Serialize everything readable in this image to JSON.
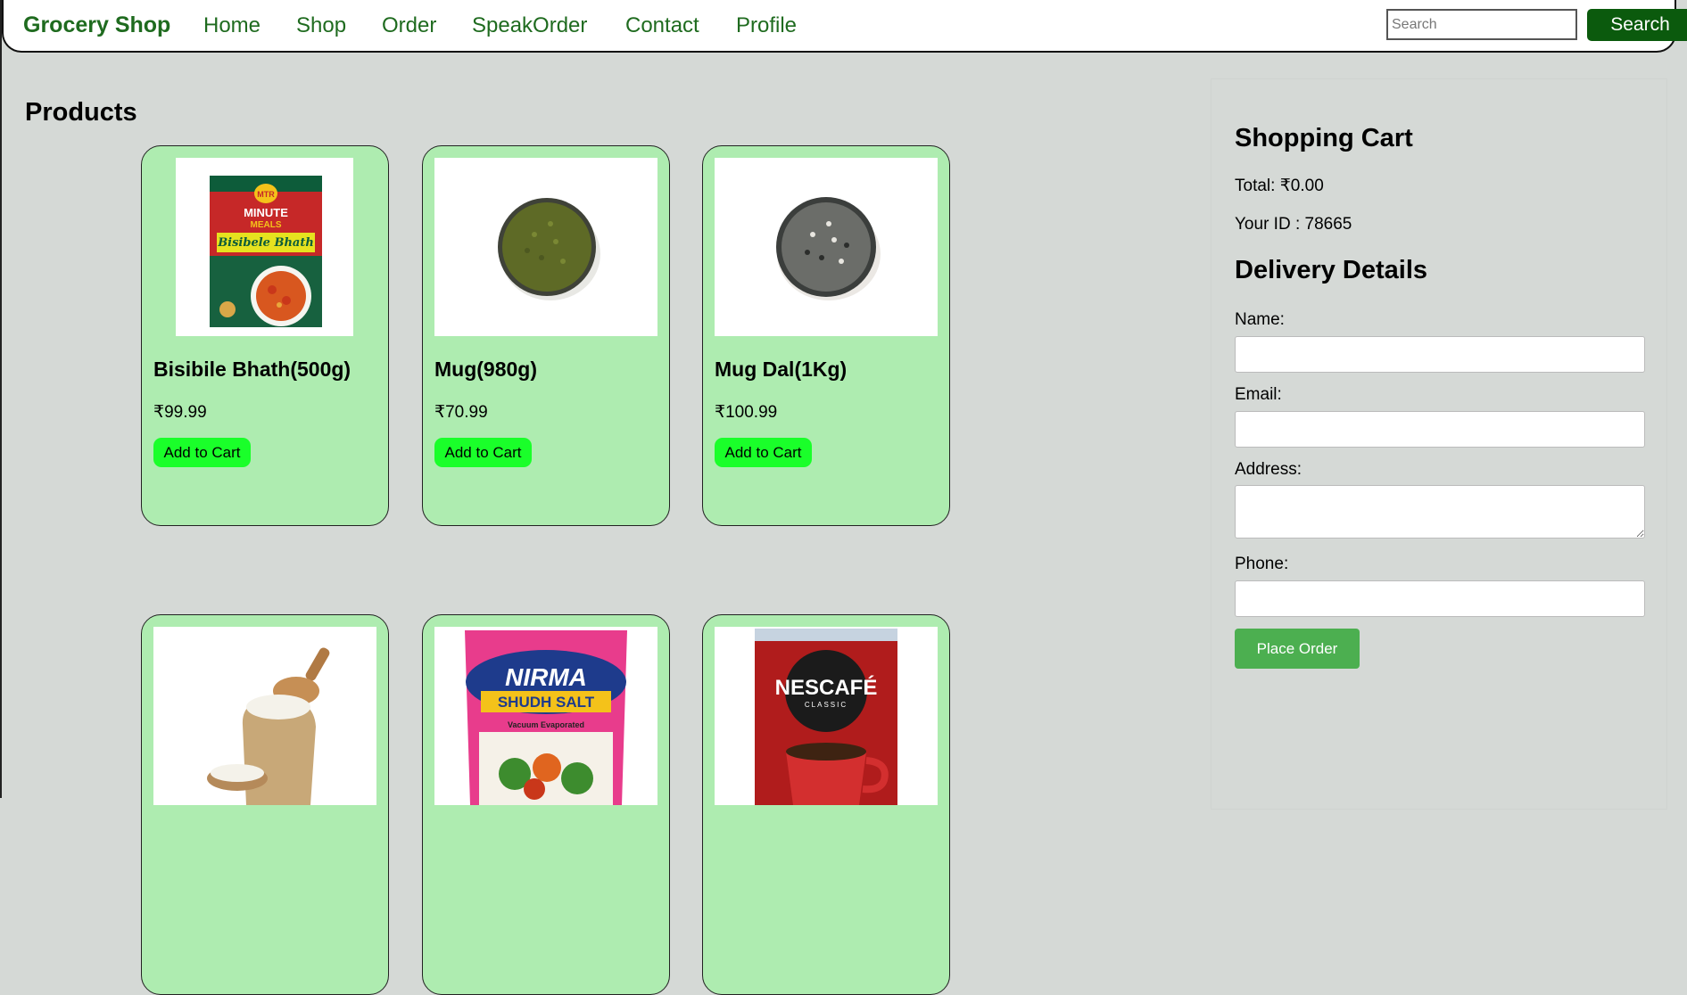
{
  "navbar": {
    "brand": "Grocery Shop",
    "links": [
      "Home",
      "Shop",
      "Order",
      "SpeakOrder",
      "Contact",
      "Profile"
    ],
    "search_placeholder": "Search",
    "search_button": "Search"
  },
  "products": {
    "heading": "Products",
    "add_label": "Add to Cart",
    "items": [
      {
        "name": "Bisibile Bhath(500g)",
        "price": "₹99.99"
      },
      {
        "name": "Mug(980g)",
        "price": "₹70.99"
      },
      {
        "name": "Mug Dal(1Kg)",
        "price": "₹100.99"
      },
      {
        "name": "",
        "price": ""
      },
      {
        "name": "",
        "price": ""
      },
      {
        "name": "",
        "price": ""
      }
    ],
    "image_text": {
      "mtr_brand": "MTR",
      "mtr_line1": "MINUTE",
      "mtr_line2": "MEALS",
      "mtr_product": "Bisibele Bhath",
      "nirma_brand": "NIRMA",
      "nirma_product": "SHUDH SALT",
      "nirma_sub": "Vacuum Evaporated",
      "nescafe_brand": "NESCAFÉ",
      "nescafe_sub": "CLASSIC"
    }
  },
  "cart": {
    "heading": "Shopping Cart",
    "total": "Total: ₹0.00",
    "user_id": "Your ID : 78665"
  },
  "delivery": {
    "heading": "Delivery Details",
    "name_label": "Name:",
    "email_label": "Email:",
    "address_label": "Address:",
    "phone_label": "Phone:",
    "place_order": "Place Order"
  },
  "colors": {
    "page_bg": "#d5d9d6",
    "brand_green": "#1f6b1f",
    "card_bg": "#aeecb0",
    "add_button": "#1aff2a",
    "search_button": "#0b5a0d",
    "place_order": "#4caf50"
  }
}
